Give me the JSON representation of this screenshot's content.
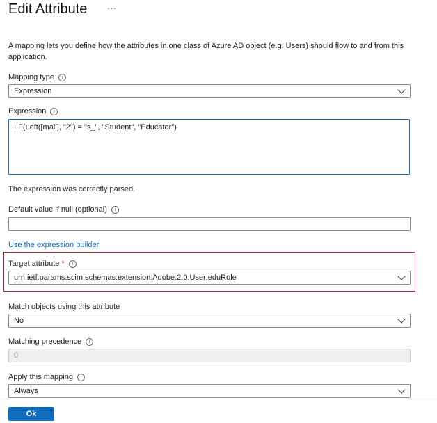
{
  "header": {
    "title": "Edit Attribute",
    "more_label": "···"
  },
  "description": "A mapping lets you define how the attributes in one class of Azure AD object (e.g. Users) should flow to and from this application.",
  "mapping_type": {
    "label": "Mapping type",
    "value": "Expression"
  },
  "expression": {
    "label": "Expression",
    "value": "IIF(Left([mail], \"2\") = \"s_\", \"Student\", \"Educator\")"
  },
  "parse_status": "The expression was correctly parsed.",
  "default_value": {
    "label": "Default value if null (optional)",
    "value": ""
  },
  "expression_builder_link": "Use the expression builder",
  "target_attribute": {
    "label": "Target attribute",
    "required_mark": "*",
    "value": "urn:ietf:params:scim:schemas:extension:Adobe:2.0:User:eduRole"
  },
  "match_objects": {
    "label": "Match objects using this attribute",
    "value": "No"
  },
  "matching_precedence": {
    "label": "Matching precedence",
    "value": "0"
  },
  "apply_mapping": {
    "label": "Apply this mapping",
    "value": "Always"
  },
  "footer": {
    "ok_label": "Ok"
  },
  "colors": {
    "accent": "#0f6cbd",
    "highlight_border": "#a4262c",
    "required": "#c50f1f"
  }
}
